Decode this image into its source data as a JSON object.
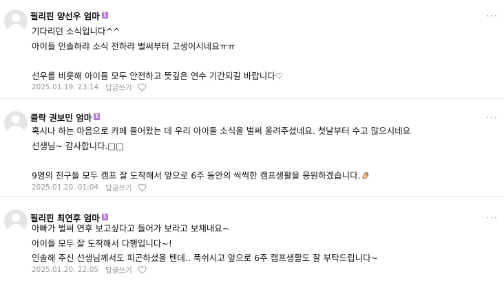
{
  "comments": [
    {
      "author": "필리핀 양선우 엄마",
      "badge": "1",
      "lines": [
        "기다리던 소식입니다^^",
        "아이들 인솔하랴 소식 전하랴 벌써부터 고생이시네요ㅠㅠ",
        "",
        "선우를 비롯해 아이들 모두 안전하고 뜻깊은 연수 기간되길 바랍니다♡"
      ],
      "timestamp": "2025.01.19. 23:14",
      "reply_label": "답글쓰기",
      "like_icon": "heart-outline-icon",
      "more_icon": "more-dots-icon"
    },
    {
      "author": "클락 권보민 엄마",
      "badge": "1",
      "lines": [
        "혹시나 하는 마음으로 카페 들어왔는 데 우리 아이들 소식을 벌써 올려주셨네요. 첫날부터 수고 많으시네요",
        "선생님~ 감사합니다.□□",
        "",
        "9명의 친구들 모두 캠프 잘 도착해서 앞으로 6주 동안의 씩씩한 캠프생활을 응원하겠습니다."
      ],
      "line_end_emoji": "clapping-hands-icon",
      "timestamp": "2025.01.20. 01:04",
      "reply_label": "답글쓰기",
      "like_icon": "heart-outline-icon",
      "more_icon": "more-dots-icon"
    },
    {
      "author": "필리핀 최연후 엄마",
      "badge": "1",
      "lines": [
        "아빠가 벌써 연후 보고싶다고 들어가 보라고 보채내요~",
        "아이들 모두 잘 도착해서 다행입니다~!",
        "인솔해 주신 선생님께서도 피곤하셨을 텐데.. 푹쉬시고 앞으로 6주 캠프생활도 잘 부탁드립니다~"
      ],
      "timestamp": "2025.01.20. 22:05",
      "reply_label": "답글쓰기",
      "like_icon": "heart-outline-icon",
      "more_icon": "more-dots-icon"
    }
  ],
  "colors": {
    "badge": "#b679d9",
    "meta_text": "#979797",
    "avatar_bg": "#e5e5e5",
    "divider": "#ebebeb"
  }
}
